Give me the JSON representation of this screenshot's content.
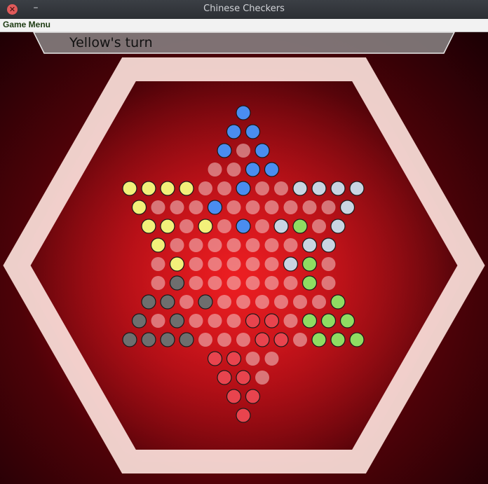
{
  "window": {
    "title": "Chinese Checkers"
  },
  "menu": {
    "game_menu": "Game Menu"
  },
  "status": {
    "turn_text": "Yellow's turn"
  },
  "colors": {
    "empty": "#f4c8c8",
    "blue": "#4a8df0",
    "yellow": "#f2f07a",
    "green": "#8fdc62",
    "red": "#e8444e",
    "gray": "#6e6e6e",
    "silver": "#c9d4e2",
    "frame": "#ffe6e0"
  },
  "board": {
    "rows": [
      [
        "B"
      ],
      [
        "B",
        "B"
      ],
      [
        "B",
        ".",
        "B"
      ],
      [
        ".",
        ".",
        "B",
        "B"
      ],
      [
        "Y",
        "Y",
        "Y",
        "Y",
        ".",
        ".",
        "B",
        ".",
        ".",
        "S",
        "S",
        "S",
        "S"
      ],
      [
        "Y",
        ".",
        ".",
        ".",
        "B",
        ".",
        ".",
        ".",
        ".",
        ".",
        ".",
        "S"
      ],
      [
        "Y",
        "Y",
        ".",
        "Y",
        ".",
        "B",
        ".",
        "S",
        "G",
        ".",
        "S"
      ],
      [
        "Y",
        ".",
        ".",
        ".",
        ".",
        ".",
        ".",
        ".",
        "S",
        "S"
      ],
      [
        ".",
        "Y",
        ".",
        ".",
        ".",
        ".",
        ".",
        "S",
        "G",
        "."
      ],
      [
        ".",
        "K",
        ".",
        ".",
        ".",
        ".",
        ".",
        ".",
        "G",
        "."
      ],
      [
        "K",
        "K",
        ".",
        "K",
        ".",
        ".",
        ".",
        ".",
        ".",
        ".",
        "G"
      ],
      [
        "K",
        ".",
        "K",
        ".",
        ".",
        ".",
        "R",
        "R",
        ".",
        "G",
        "G",
        "G"
      ],
      [
        "K",
        "K",
        "K",
        "K",
        ".",
        ".",
        ".",
        "R",
        "R",
        ".",
        "G",
        "G",
        "G"
      ],
      [
        "R",
        "R",
        ".",
        "."
      ],
      [
        "R",
        "R",
        "."
      ],
      [
        "R",
        "R"
      ],
      [
        "R"
      ]
    ]
  }
}
